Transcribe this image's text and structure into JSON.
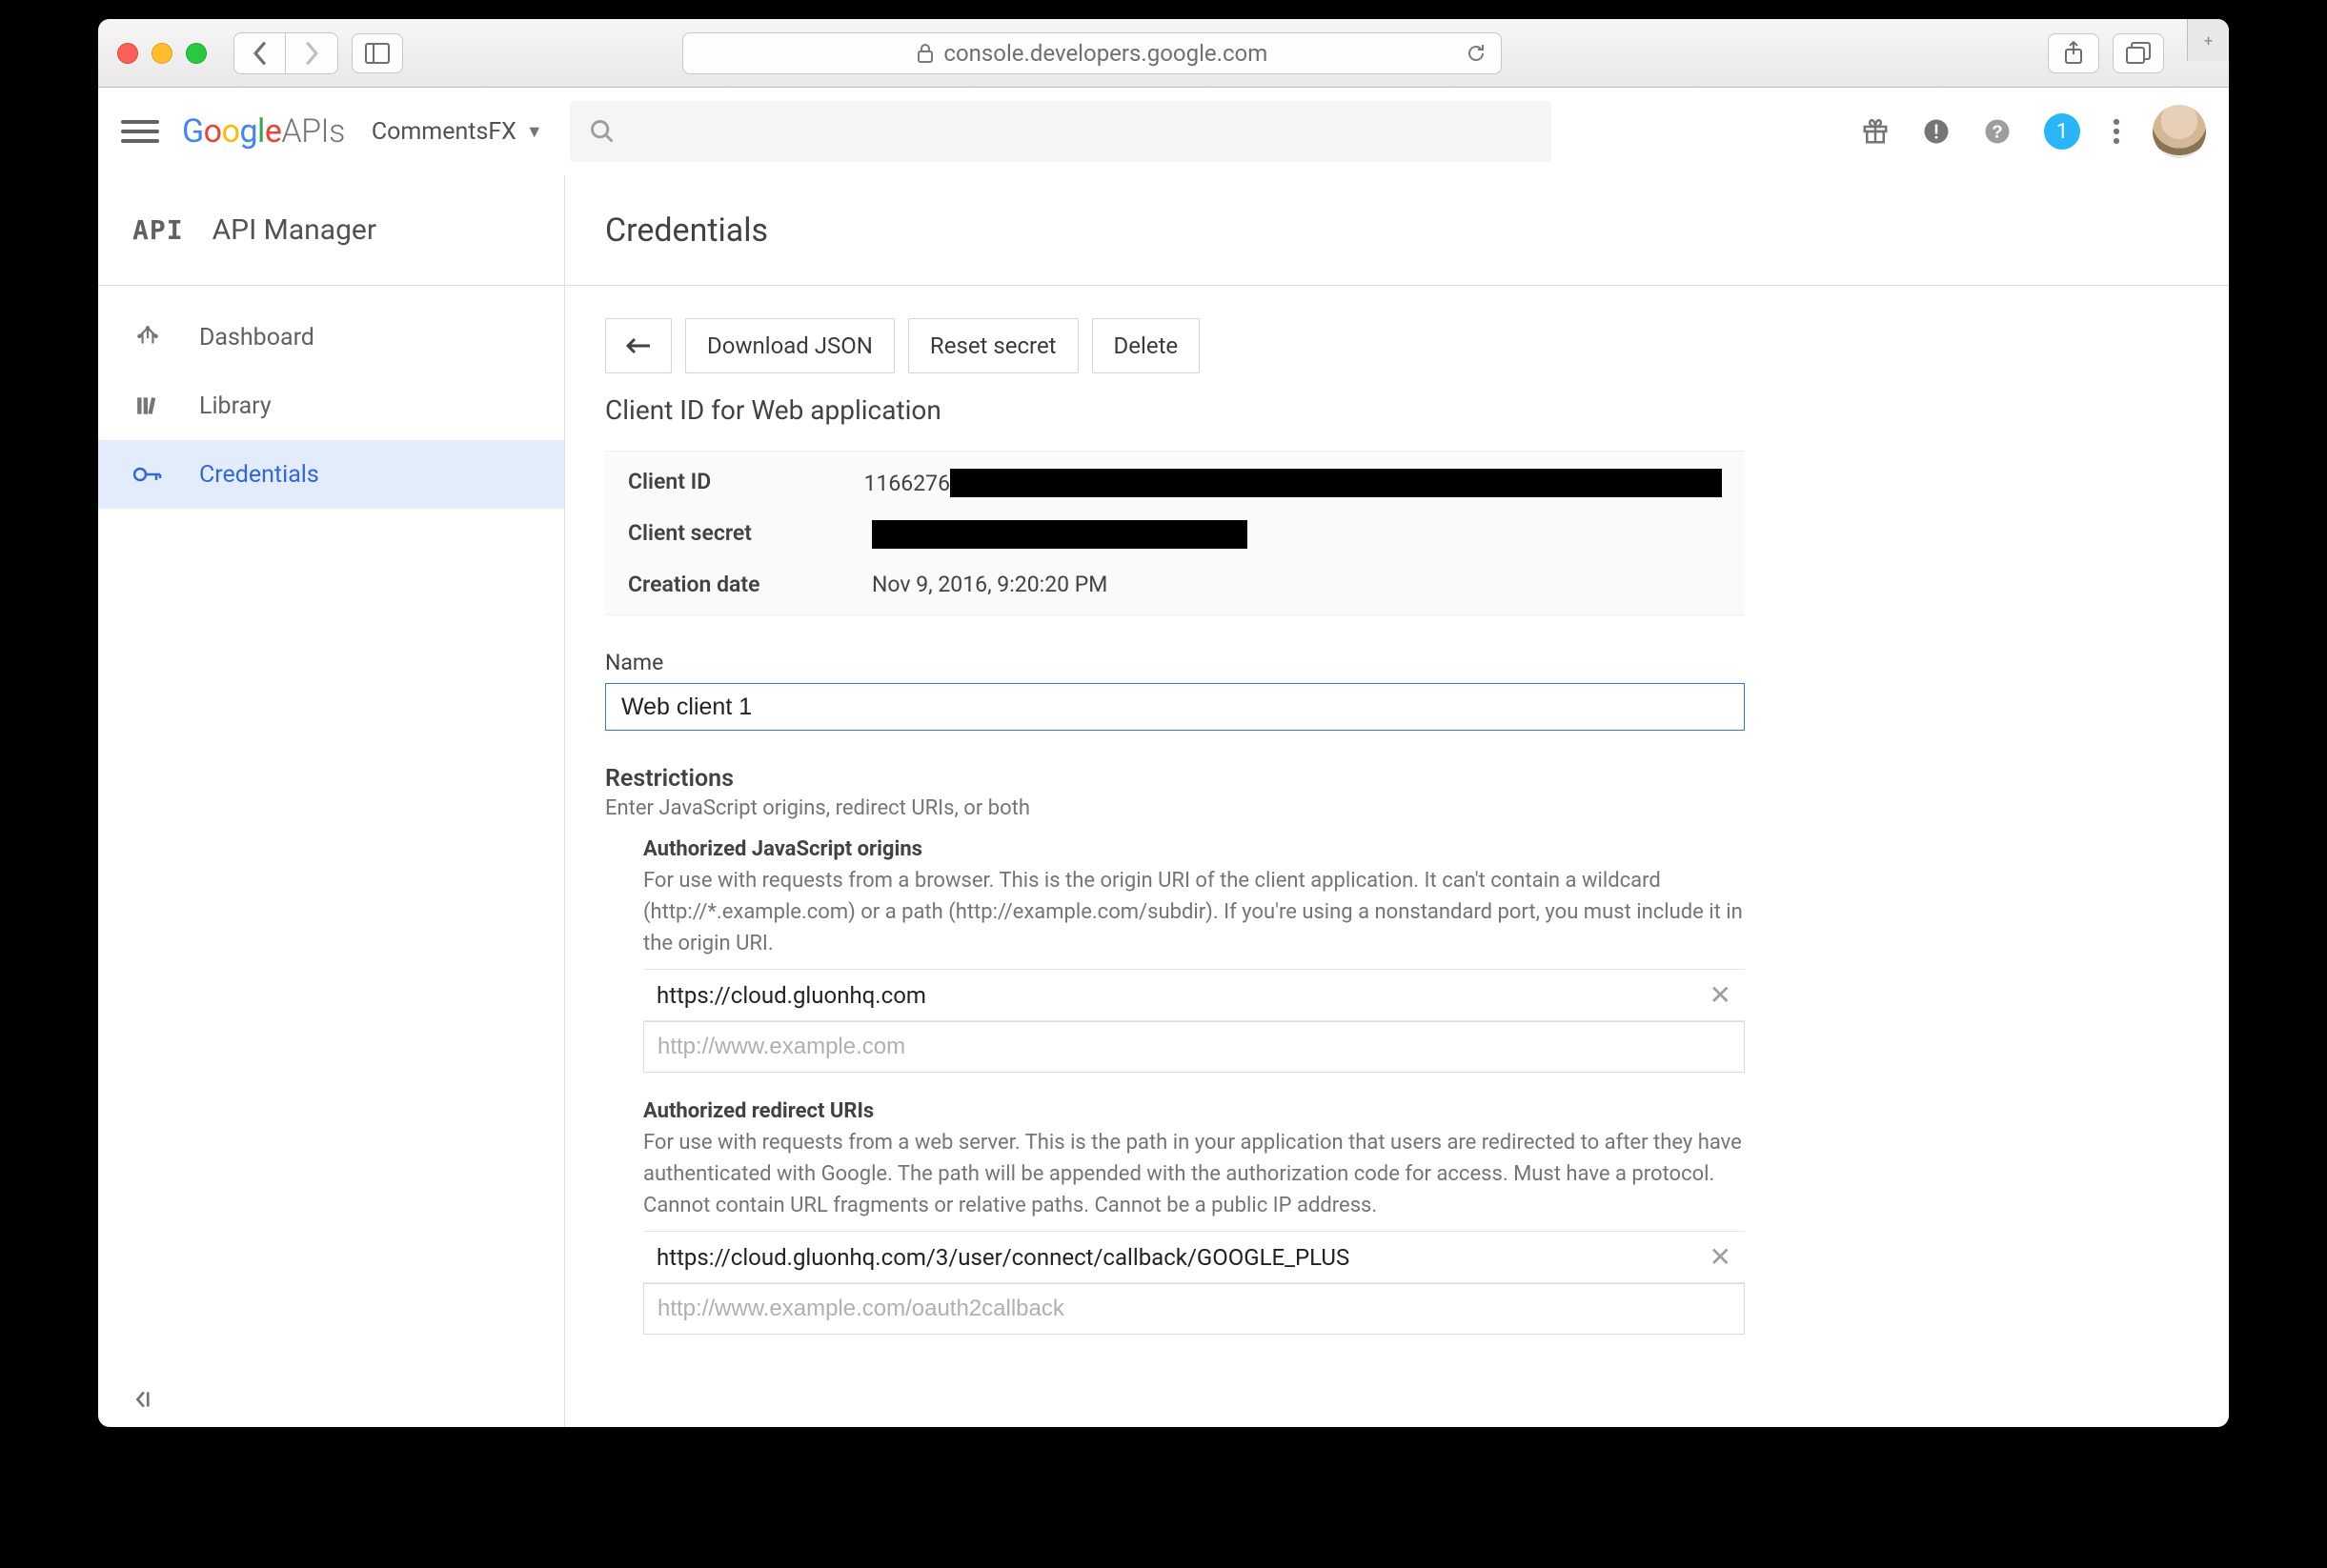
{
  "browser": {
    "url": "console.developers.google.com"
  },
  "header": {
    "logo_apis": "APIs",
    "project_name": "CommentsFX",
    "notification_count": "1"
  },
  "sidebar": {
    "title_mono": "API",
    "title": "API Manager",
    "items": [
      {
        "label": "Dashboard"
      },
      {
        "label": "Library"
      },
      {
        "label": "Credentials"
      }
    ]
  },
  "page": {
    "title": "Credentials",
    "actions": {
      "download": "Download JSON",
      "reset": "Reset secret",
      "delete": "Delete"
    },
    "section_heading": "Client ID for Web application",
    "info": {
      "client_id_label": "Client ID",
      "client_id_prefix": "1166276",
      "client_secret_label": "Client secret",
      "creation_label": "Creation date",
      "creation_value": "Nov 9, 2016, 9:20:20 PM"
    },
    "name_label": "Name",
    "name_value": "Web client 1",
    "restrictions": {
      "heading": "Restrictions",
      "sub": "Enter JavaScript origins, redirect URIs, or both",
      "js_origins": {
        "title": "Authorized JavaScript origins",
        "desc": "For use with requests from a browser. This is the origin URI of the client application. It can't contain a wildcard (http://*.example.com) or a path (http://example.com/subdir). If you're using a nonstandard port, you must include it in the origin URI.",
        "value": "https://cloud.gluonhq.com",
        "placeholder": "http://www.example.com"
      },
      "redirect": {
        "title": "Authorized redirect URIs",
        "desc": "For use with requests from a web server. This is the path in your application that users are redirected to after they have authenticated with Google. The path will be appended with the authorization code for access. Must have a protocol. Cannot contain URL fragments or relative paths. Cannot be a public IP address.",
        "value": "https://cloud.gluonhq.com/3/user/connect/callback/GOOGLE_PLUS",
        "placeholder": "http://www.example.com/oauth2callback"
      }
    }
  }
}
